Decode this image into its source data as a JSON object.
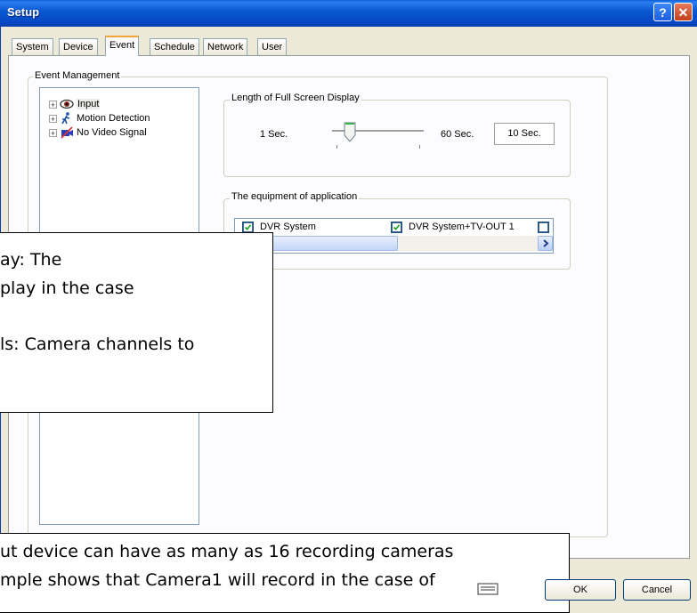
{
  "window": {
    "title": "Setup",
    "help_label": "?",
    "close_label": "✕"
  },
  "tabs": [
    {
      "label": "System"
    },
    {
      "label": "Device"
    },
    {
      "label": "Event",
      "active": true
    },
    {
      "label": "Schedule"
    },
    {
      "label": "Network"
    },
    {
      "label": "User"
    }
  ],
  "event_management": {
    "legend": "Event Management",
    "tree": [
      {
        "label": "Input",
        "icon": "eye-icon",
        "selected": true
      },
      {
        "label": "Motion Detection",
        "icon": "running-person-icon"
      },
      {
        "label": "No Video Signal",
        "icon": "no-video-icon"
      }
    ]
  },
  "full_screen_display": {
    "legend": "Length of Full Screen Display",
    "min_label": "1 Sec.",
    "max_label": "60 Sec.",
    "value_label": "10 Sec."
  },
  "equipment": {
    "legend": "The equipment of application",
    "items": [
      {
        "label": "DVR System",
        "checked": true
      },
      {
        "label": "DVR System+TV-OUT 1",
        "checked": true
      },
      {
        "label": "",
        "checked": false
      }
    ]
  },
  "overlay_top": {
    "line1": "ay: The",
    "line2": "play in the case",
    "line3": "ls: Camera channels to"
  },
  "overlay_bottom": {
    "line1": "ut device can have as many as 16 recording cameras",
    "line2": "mple shows that Camera1 will record in the case of"
  },
  "buttons": {
    "ok": "OK",
    "cancel": "Cancel"
  },
  "colors": {
    "titlebar": "#0a5fd8",
    "tab_highlight": "#f5a53a",
    "panel": "#fcfcfe"
  }
}
